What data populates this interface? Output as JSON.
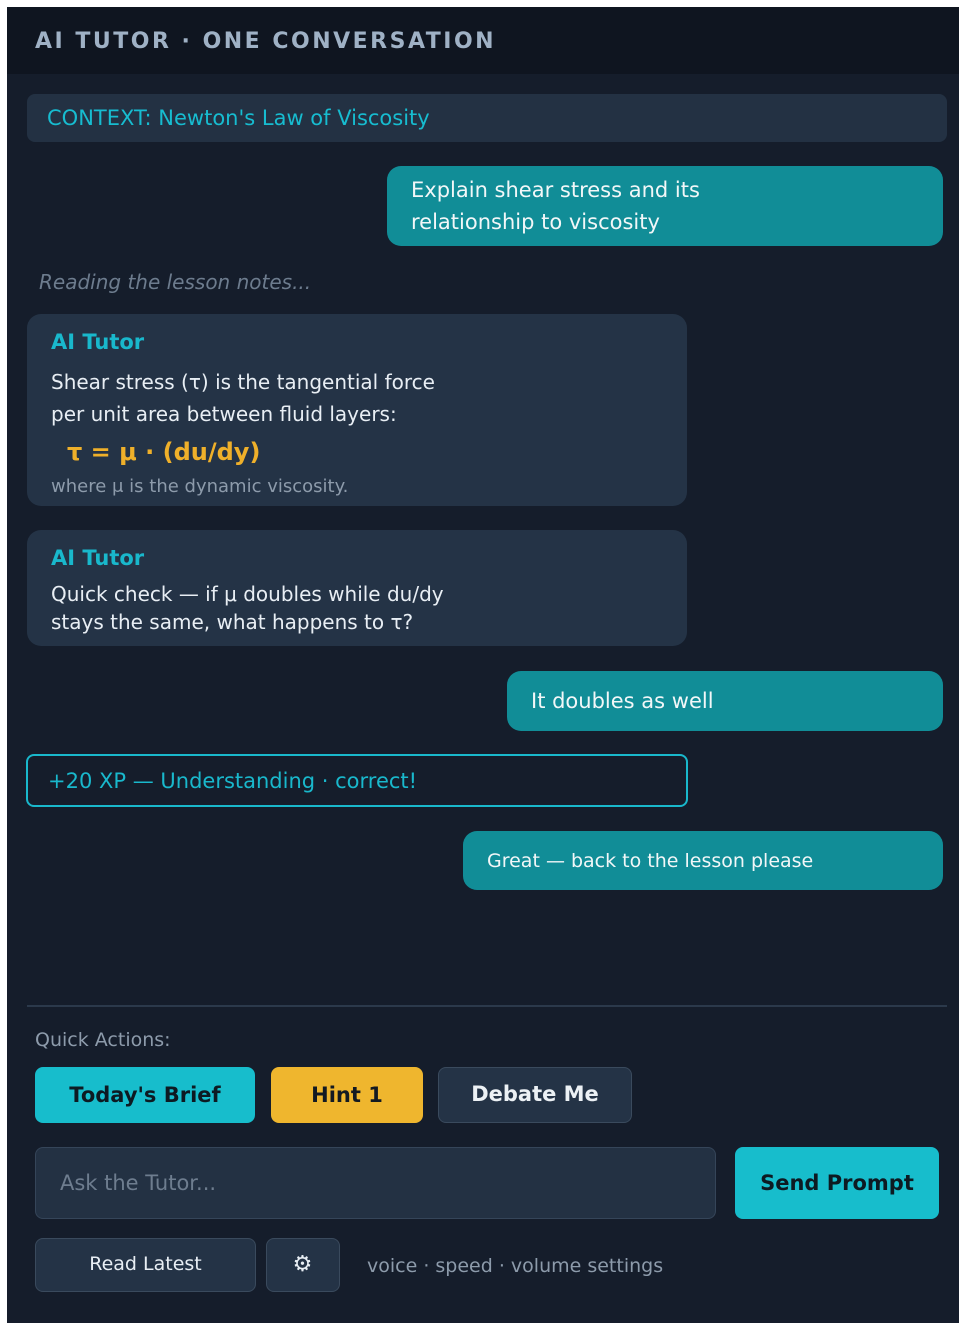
{
  "header": {
    "title": "AI TUTOR · ONE CONVERSATION"
  },
  "context": {
    "text": "CONTEXT: Newton's Law of Viscosity"
  },
  "messages": {
    "user_1": {
      "line1": "Explain shear stress and its",
      "line2": "relationship to viscosity"
    },
    "status": "Reading the lesson notes...",
    "ai_1": {
      "name": "AI Tutor",
      "line1": "Shear stress (τ) is the tangential force",
      "line2": "per unit area between fluid layers:",
      "formula": "τ = μ · (du/dy)",
      "note": "where μ is the dynamic viscosity."
    },
    "ai_2": {
      "name": "AI Tutor",
      "line1": "Quick check — if μ doubles while du/dy",
      "line2": "stays the same, what happens to τ?"
    },
    "user_2": "It doubles as well",
    "xp": "+20 XP — Understanding · correct!",
    "user_3": "Great — back to the lesson please"
  },
  "quick_actions": {
    "label": "Quick Actions:",
    "brief": "Today's Brief",
    "hint": "Hint 1",
    "debate": "Debate Me"
  },
  "input": {
    "placeholder": "Ask the Tutor...",
    "value": ""
  },
  "send": {
    "label": "Send Prompt"
  },
  "footer": {
    "read_latest": "Read Latest",
    "settings_icon": "gear-icon",
    "settings_label": "voice · speed · volume settings"
  },
  "colors": {
    "accent_teal": "#17bdcc",
    "hint_amber": "#efb62e",
    "formula_amber": "#efb02a",
    "user_bubble": "#118d97",
    "background": "#151d2b"
  }
}
